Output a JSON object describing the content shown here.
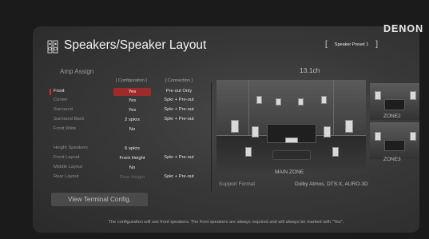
{
  "brand": "DENON",
  "page_title": "Speakers/Speaker Layout",
  "preset": {
    "label": "Speaker Preset 1",
    "open": "[",
    "close": "]"
  },
  "amp_assign": {
    "section_label": "Amp Assign",
    "col_configuration": "[ Configuration ]",
    "col_connection": "[ Connection ]",
    "rows": [
      {
        "label": "Front",
        "configuration": "Yes",
        "connection": "Pre-out Only"
      },
      {
        "label": "Center",
        "configuration": "Yes",
        "connection": "Spkr + Pre-out"
      },
      {
        "label": "Surround",
        "configuration": "Yes",
        "connection": "Spkr + Pre-out"
      },
      {
        "label": "Surround Back",
        "configuration": "2 spkrs",
        "connection": "Spkr + Pre-out"
      },
      {
        "label": "Front Wide",
        "configuration": "No",
        "connection": ""
      },
      {
        "label": "Height Speakers",
        "configuration": "6 spkrs",
        "connection": ""
      },
      {
        "label": "Front Layout",
        "configuration": "Front Height",
        "connection": "Spkr + Pre-out"
      },
      {
        "label": "Middle Layout",
        "configuration": "No",
        "connection": ""
      },
      {
        "label": "Rear Layout",
        "configuration": "Rear Height",
        "connection": "Spkr + Pre-out"
      }
    ]
  },
  "channel_count": "13.1ch",
  "zones": {
    "main": "MAIN ZONE",
    "zone2": "ZONE2",
    "zone3": "ZONE3"
  },
  "support_format": {
    "label": "Support Format",
    "value": "Dolby Atmos, DTS:X, AURO-3D"
  },
  "view_terminal_button": "View Terminal Config.",
  "footer_text": "The configuration will use front speakers. The front speakers are always required and will always be marked with \"Yes\"."
}
